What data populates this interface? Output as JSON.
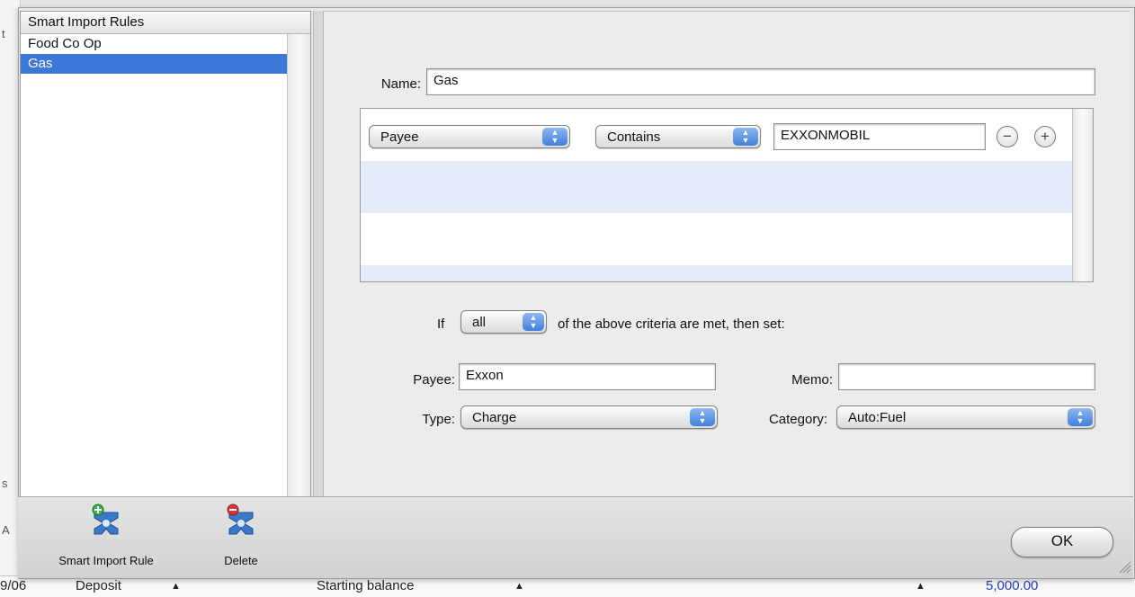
{
  "rules_list": {
    "header": "Smart Import Rules",
    "items": [
      {
        "label": "Food Co Op",
        "selected": false
      },
      {
        "label": "Gas",
        "selected": true
      }
    ]
  },
  "rule_editor": {
    "name_label": "Name:",
    "name_value": "Gas",
    "criteria": [
      {
        "field": "Payee",
        "operator": "Contains",
        "value": "EXXONMOBIL"
      }
    ],
    "remove_symbol": "−",
    "add_symbol": "+",
    "match_prefix": "If",
    "match_mode": "all",
    "match_suffix": "of the above criteria are met, then set:",
    "payee_label": "Payee:",
    "payee_value": "Exxon",
    "memo_label": "Memo:",
    "memo_value": "",
    "type_label": "Type:",
    "type_value": "Charge",
    "category_label": "Category:",
    "category_value": "Auto:Fuel"
  },
  "toolbar": {
    "add_rule_label": "Smart Import Rule",
    "delete_label": "Delete",
    "ok_label": "OK"
  },
  "background_window": {
    "left_letters": [
      "t",
      "s",
      "A"
    ],
    "bottom_row": {
      "date": "9/06",
      "type": "Deposit",
      "description": "Starting balance",
      "amount": "5,000.00"
    }
  },
  "colors": {
    "selection": "#3c78d8",
    "popup_arrow": "#3f7fdc",
    "add_badge": "#3cb04a",
    "delete_badge": "#d03a3a"
  }
}
